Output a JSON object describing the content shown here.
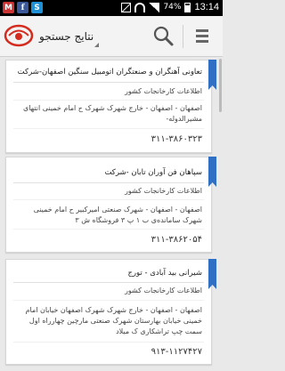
{
  "status_bar": {
    "battery": "74%",
    "time": "13:14",
    "left_icons": [
      "mail-icon",
      "facebook-icon",
      "skype-icon"
    ]
  },
  "action_bar": {
    "title": "نتایج جستجو"
  },
  "results": [
    {
      "name": "تعاونی آهنگران و صنعتگران اتومبیل سنگین اصفهان-شرکت",
      "category": "اطلاعات کارخانجات کشور",
      "address": "اصفهان - اصفهان - خارج شهرک شهرک ح امام خمینی انتهای مشیرالدوله-",
      "phone": "۳۱۱-۳۸۶۰۳۲۳"
    },
    {
      "name": "سپاهان فن آوران تابان -شرکت",
      "category": "اطلاعات کارخانجات کشور",
      "address": "اصفهان - اصفهان - شهرک صنعتی امیرکبیر ح امام خمینی شهرک سامانده‌ی ب ۱ پ ۳ فروشگاه ش ۳",
      "phone": "۳۱۱-۳۸۶۲۰۵۴"
    },
    {
      "name": "شیرانی بید آبادی - تورج",
      "category": "اطلاعات کارخانجات کشور",
      "address": "اصفهان - اصفهان - خارج شهرک شهرک اصفهان خیابان امام خمینی خیابان بهارستان شهرک صنعتی مارچین چهارراه اول سمت چپ تراشکاری ک میلاد",
      "phone": "۹۱۳-۱۱۲۷۴۲۷"
    }
  ]
}
